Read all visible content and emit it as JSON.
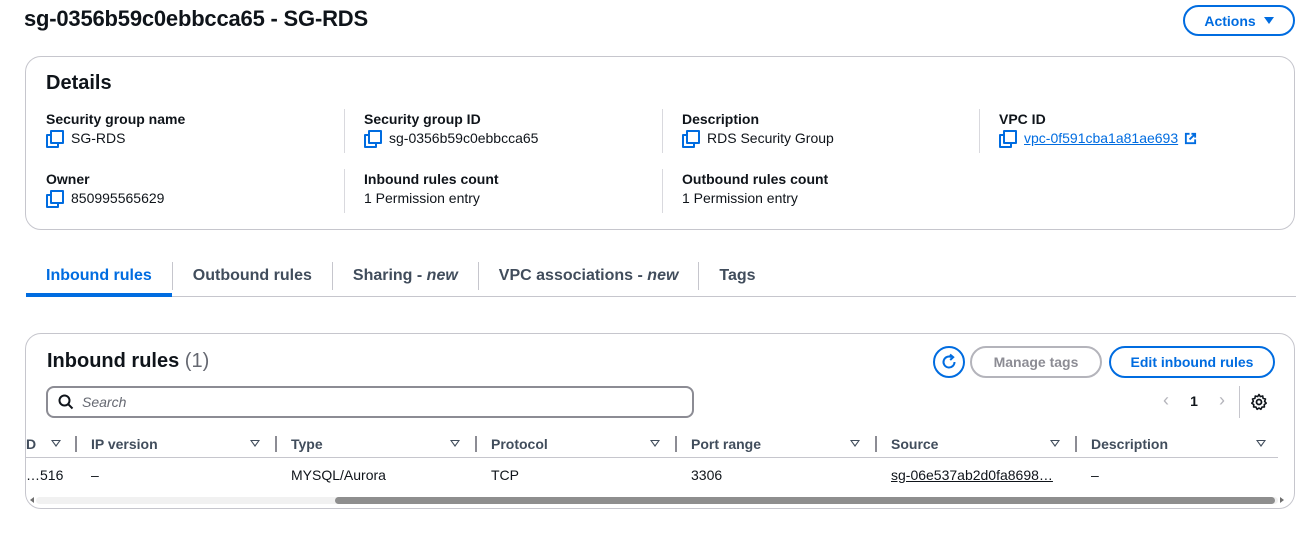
{
  "header": {
    "title": "sg-0356b59c0ebbcca65 - SG-RDS",
    "actions_label": "Actions"
  },
  "details": {
    "heading": "Details",
    "fields": [
      {
        "label": "Security group name",
        "value": "SG-RDS",
        "copy": true
      },
      {
        "label": "Security group ID",
        "value": "sg-0356b59c0ebbcca65",
        "copy": true
      },
      {
        "label": "Description",
        "value": "RDS Security Group",
        "copy": true
      },
      {
        "label": "VPC ID",
        "value": "vpc-0f591cba1a81ae693",
        "copy": true,
        "link": true,
        "external": true
      },
      {
        "label": "Owner",
        "value": "850995565629",
        "copy": true
      },
      {
        "label": "Inbound rules count",
        "value": "1 Permission entry"
      },
      {
        "label": "Outbound rules count",
        "value": "1 Permission entry"
      }
    ]
  },
  "tabs": [
    {
      "label": "Inbound rules",
      "active": true
    },
    {
      "label": "Outbound rules",
      "active": false
    },
    {
      "label": "Sharing - ",
      "suffix": "new",
      "active": false
    },
    {
      "label": "VPC associations - ",
      "suffix": "new",
      "active": false
    },
    {
      "label": "Tags",
      "active": false
    }
  ],
  "inbound": {
    "title": "Inbound rules",
    "count": "(1)",
    "manage_tags_label": "Manage tags",
    "edit_label": "Edit inbound rules",
    "search_placeholder": "Search",
    "page_number": "1",
    "columns": [
      "D",
      "IP version",
      "Type",
      "Protocol",
      "Port range",
      "Source",
      "Description"
    ],
    "rows": [
      {
        "id": "…516",
        "ip_version": "–",
        "type": "MYSQL/Aurora",
        "protocol": "TCP",
        "port_range": "3306",
        "source": "sg-06e537ab2d0fa8698…",
        "description": "–"
      }
    ]
  },
  "colors": {
    "accent": "#006ce0",
    "text": "#0f141a",
    "disabled": "#8c8c94"
  }
}
